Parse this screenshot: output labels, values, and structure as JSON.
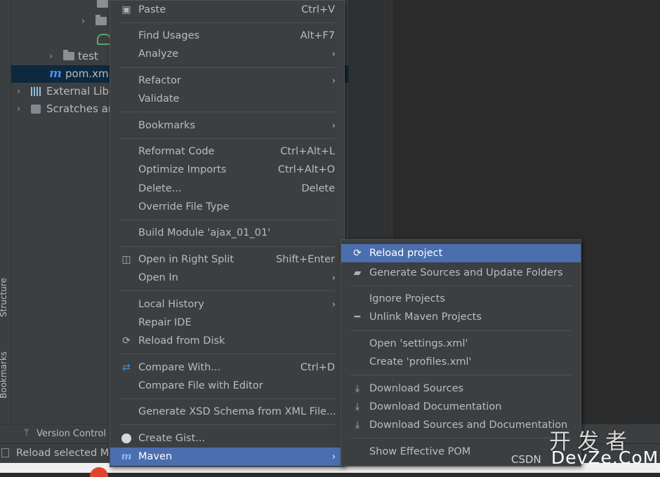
{
  "project_tree": {
    "rows": [
      {
        "label": "test"
      },
      {
        "label": "pom.xml"
      },
      {
        "label": "External Lib"
      },
      {
        "label": "Scratches ar"
      }
    ]
  },
  "side_tabs": {
    "structure": "Structure",
    "bookmarks": "Bookmarks"
  },
  "bottom_bar": {
    "version_control": "Version Control"
  },
  "status_bar": {
    "text": "Reload selected M"
  },
  "context_menu": {
    "items": [
      {
        "label": "Paste",
        "shortcut": "Ctrl+V",
        "icon": "clipboard-icon"
      },
      {
        "label": "Find Usages",
        "shortcut": "Alt+F7"
      },
      {
        "label": "Analyze",
        "submenu": true
      },
      {
        "label": "Refactor",
        "submenu": true
      },
      {
        "label": "Validate"
      },
      {
        "label": "Bookmarks",
        "submenu": true
      },
      {
        "label": "Reformat Code",
        "shortcut": "Ctrl+Alt+L"
      },
      {
        "label": "Optimize Imports",
        "shortcut": "Ctrl+Alt+O"
      },
      {
        "label": "Delete...",
        "shortcut": "Delete"
      },
      {
        "label": "Override File Type"
      },
      {
        "label": "Build Module 'ajax_01_01'"
      },
      {
        "label": "Open in Right Split",
        "shortcut": "Shift+Enter",
        "icon": "split-icon"
      },
      {
        "label": "Open In",
        "submenu": true
      },
      {
        "label": "Local History",
        "submenu": true
      },
      {
        "label": "Repair IDE"
      },
      {
        "label": "Reload from Disk",
        "icon": "reload-icon"
      },
      {
        "label": "Compare With...",
        "shortcut": "Ctrl+D",
        "icon": "compare-icon"
      },
      {
        "label": "Compare File with Editor"
      },
      {
        "label": "Generate XSD Schema from XML File..."
      },
      {
        "label": "Create Gist...",
        "icon": "github-icon"
      },
      {
        "label": "Maven",
        "submenu": true,
        "icon": "maven-icon",
        "highlighted": true
      }
    ]
  },
  "maven_submenu": {
    "items": [
      {
        "label": "Reload project",
        "icon": "reload-icon",
        "highlighted": true
      },
      {
        "label": "Generate Sources and Update Folders",
        "icon": "generate-folder-icon"
      },
      {
        "label": "Ignore Projects"
      },
      {
        "label": "Unlink Maven Projects",
        "icon": "minus-icon"
      },
      {
        "label": "Open 'settings.xml'"
      },
      {
        "label": "Create 'profiles.xml'"
      },
      {
        "label": "Download Sources",
        "icon": "download-icon"
      },
      {
        "label": "Download Documentation",
        "icon": "download-icon"
      },
      {
        "label": "Download Sources and Documentation",
        "icon": "download-icon"
      },
      {
        "label": "Show Effective POM"
      }
    ]
  },
  "watermark": {
    "chinese": "开发者",
    "csdn": "CSDN",
    "site": "DevZe.CoM"
  },
  "colors": {
    "highlight": "#4b6eaf",
    "menu_bg": "#3c3f41",
    "editor_bg": "#2b2b2b"
  }
}
